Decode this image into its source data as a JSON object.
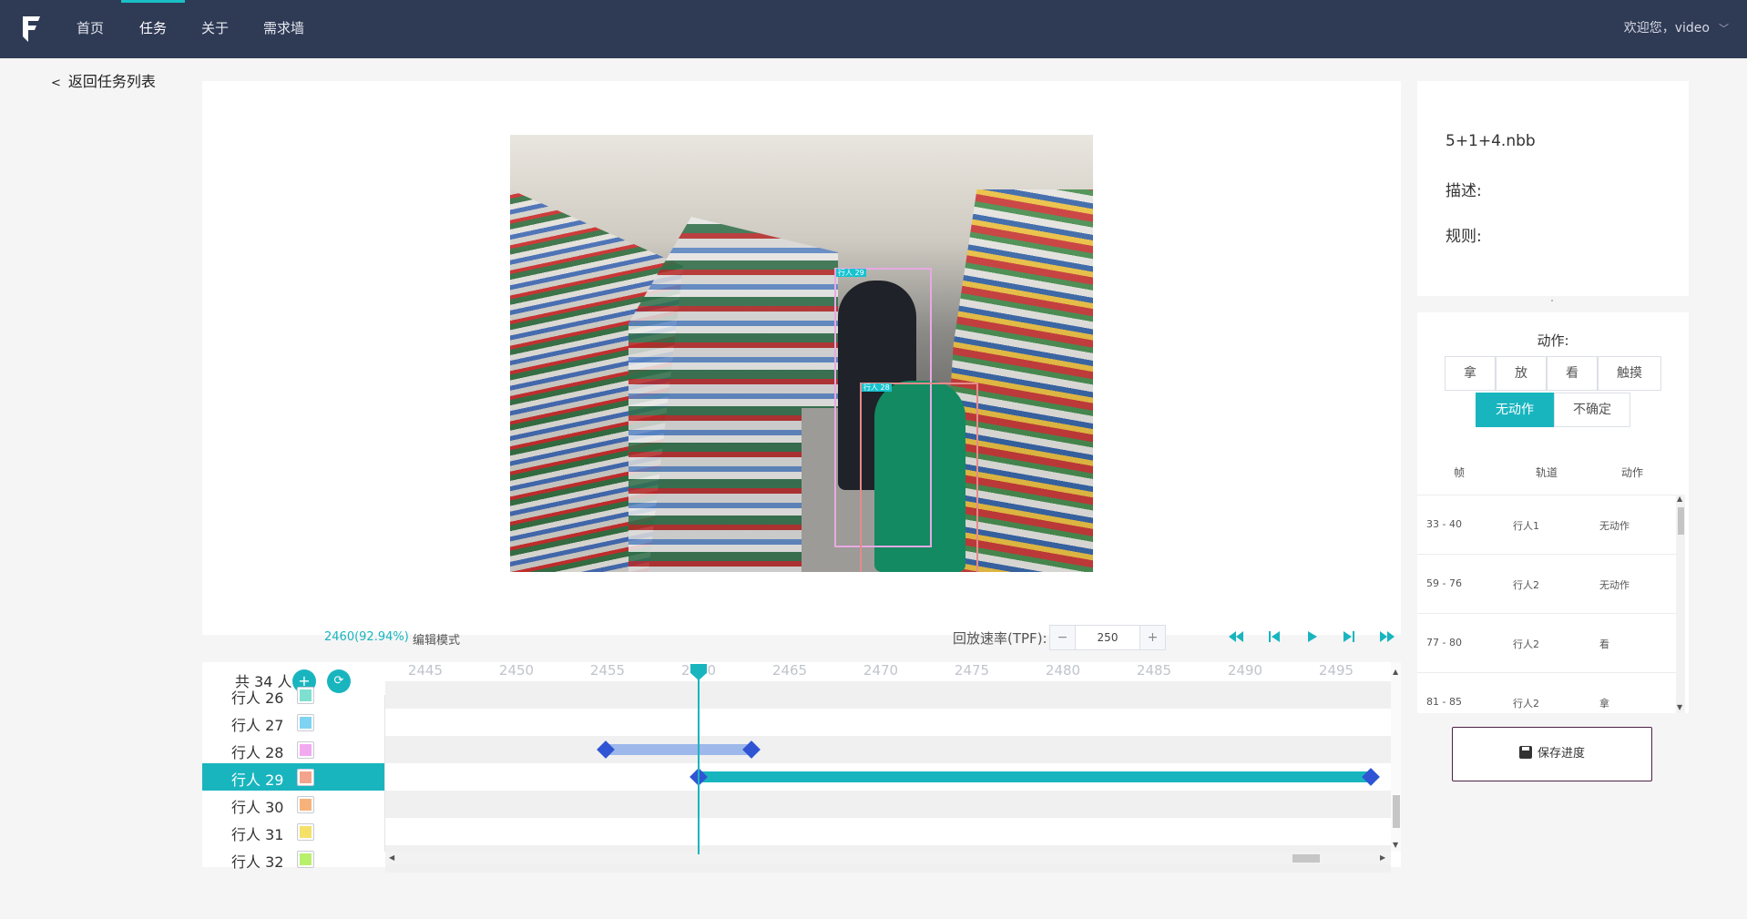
{
  "nav": {
    "items": [
      "首页",
      "任务",
      "关于",
      "需求墙"
    ],
    "active": "任务",
    "welcome": "欢迎您，video",
    "logo_icon": "brand-logo-icon"
  },
  "back_link": "返回任务列表",
  "video": {
    "annotations": [
      {
        "label": "行人 29",
        "color": "#e8a9e3"
      },
      {
        "label": "行人 28",
        "color": "#e88a8a"
      }
    ]
  },
  "playback": {
    "frame_info": "2460(92.94%)",
    "mode": "编辑模式",
    "speed_label": "回放速率(TPF):",
    "speed_value": "250",
    "minus": "−",
    "plus": "+",
    "icons": [
      "fast-backward-icon",
      "step-backward-icon",
      "play-icon",
      "step-forward-icon",
      "fast-forward-icon"
    ]
  },
  "timeline": {
    "total": "共 34 人",
    "add_icon": "+",
    "refresh_icon": "⟳",
    "ticks": [
      "2445",
      "2450",
      "2455",
      "2460",
      "2465",
      "2470",
      "2475",
      "2480",
      "2485",
      "2490",
      "2495"
    ],
    "current_frame": 2460,
    "rows": [
      {
        "name": "行人 26",
        "color": "#7ee0d0"
      },
      {
        "name": "行人 27",
        "color": "#7fd3f2"
      },
      {
        "name": "行人 28",
        "color": "#f2a9f0"
      },
      {
        "name": "行人 29",
        "color": "#f4a48c",
        "selected": true
      },
      {
        "name": "行人 30",
        "color": "#f6b27a"
      },
      {
        "name": "行人 31",
        "color": "#f5e06a"
      },
      {
        "name": "行人 32",
        "color": "#b8f06b"
      }
    ],
    "segments": [
      {
        "row": "行人 28",
        "start": 2454.9,
        "end": 2462.9,
        "color": "#9db8ea"
      },
      {
        "row": "行人 29",
        "start": 2460,
        "end": 2496.9,
        "color": "#19b5bf"
      }
    ]
  },
  "info": {
    "filename": "5+1+4.nbb",
    "desc_label": "描述:",
    "rule_label": "规则:"
  },
  "action": {
    "title": "动作:",
    "buttons": [
      "拿",
      "放",
      "看",
      "触摸"
    ],
    "buttons2": [
      "无动作",
      "不确定"
    ],
    "active": "无动作",
    "columns": [
      "帧",
      "轨道",
      "动作"
    ],
    "rows": [
      [
        "33 - 40",
        "行人1",
        "无动作"
      ],
      [
        "59 - 76",
        "行人2",
        "无动作"
      ],
      [
        "77 - 80",
        "行人2",
        "看"
      ],
      [
        "81 - 85",
        "行人2",
        "拿"
      ]
    ]
  },
  "save": {
    "label": "保存进度",
    "icon": "save-disk-icon"
  }
}
